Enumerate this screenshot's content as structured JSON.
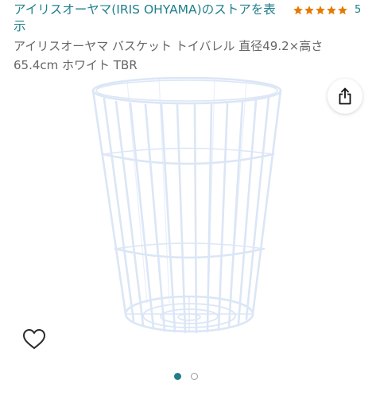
{
  "store_link": "アイリスオーヤマ(IRIS OHYAMA)のストアを表示",
  "rating": {
    "stars": 5,
    "count": "5",
    "star_color": "#e67a00"
  },
  "product": {
    "title": "アイリスオーヤマ バスケット トイバレル 直径49.2×高さ65.4cm ホワイト TBR"
  },
  "icons": {
    "share": "share-icon",
    "favorite": "heart-outline-icon"
  },
  "carousel": {
    "active_index": 1,
    "total": 2,
    "active_color": "#1f7f8c"
  },
  "colors": {
    "link": "#1f7f8c",
    "text": "#666666"
  }
}
